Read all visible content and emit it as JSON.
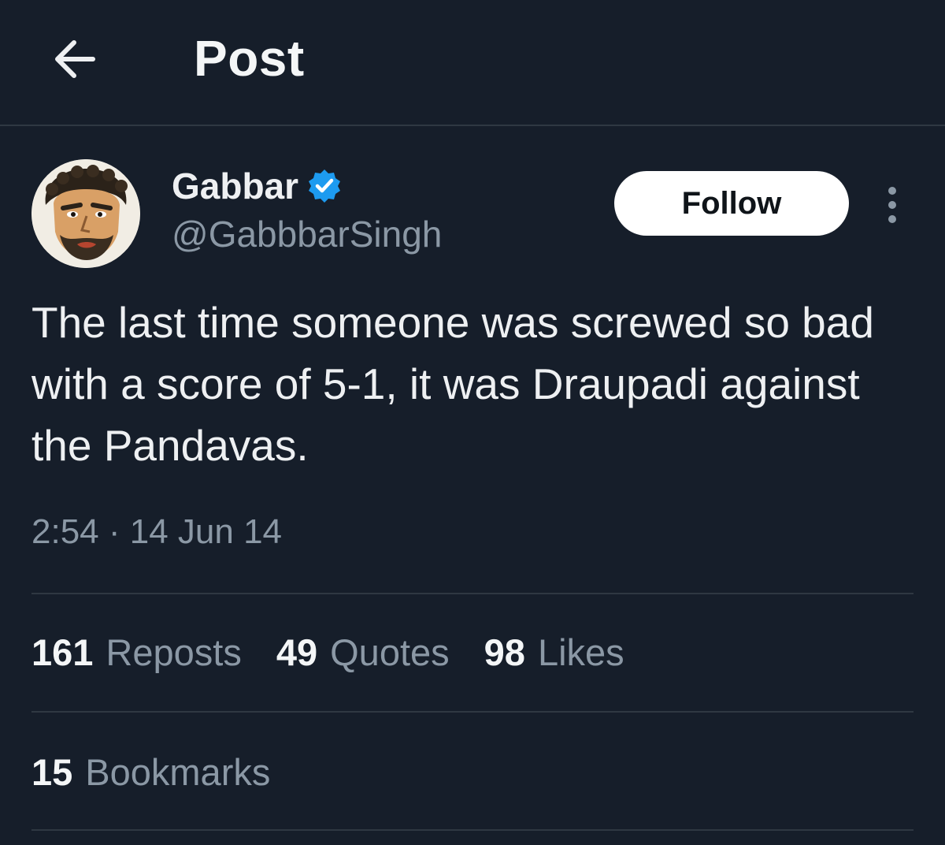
{
  "header": {
    "back_icon": "arrow-left-icon",
    "title": "Post"
  },
  "author": {
    "display_name": "Gabbar",
    "verified_icon": "verified-badge-icon",
    "verified_color": "#1d9bf0",
    "handle": "@GabbbarSingh",
    "follow_label": "Follow",
    "more_icon": "more-vertical-icon"
  },
  "tweet": {
    "text": "The last time someone was screwed so bad with a score of 5-1, it was Draupadi against the Pandavas.",
    "timestamp": "2:54 · 14 Jun 14"
  },
  "stats": {
    "reposts_count": "161",
    "reposts_label": "Reposts",
    "quotes_count": "49",
    "quotes_label": "Quotes",
    "likes_count": "98",
    "likes_label": "Likes",
    "bookmarks_count": "15",
    "bookmarks_label": "Bookmarks"
  },
  "colors": {
    "background": "#161e2a",
    "text_primary": "#eef0f2",
    "text_secondary": "#8b98a5",
    "divider": "#2f3842"
  }
}
